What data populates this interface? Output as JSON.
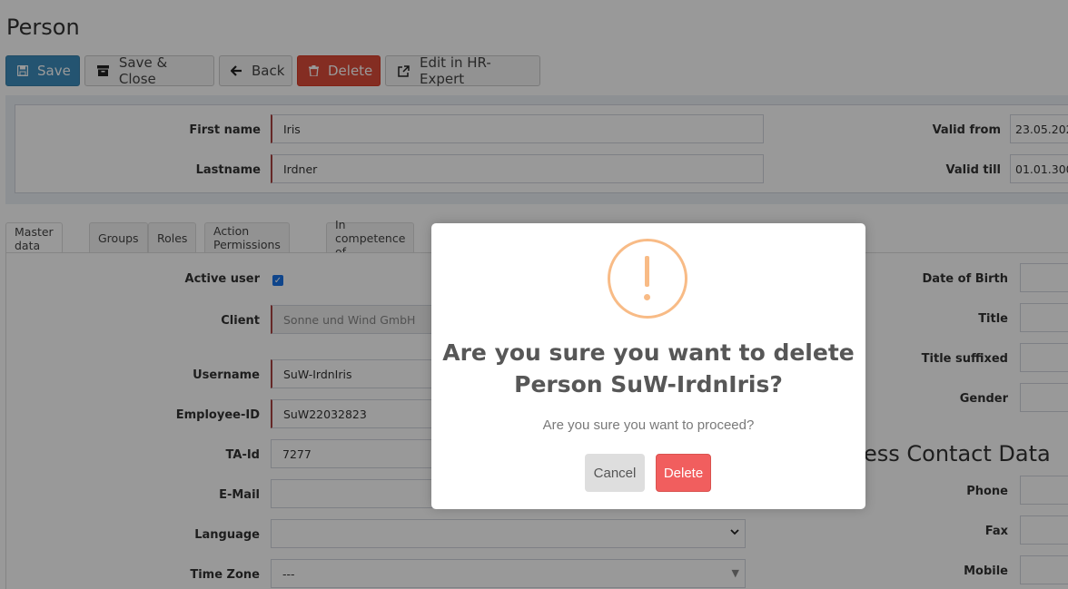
{
  "page": {
    "title": "Person"
  },
  "toolbar": {
    "save": "Save",
    "save_close": "Save & Close",
    "back": "Back",
    "delete": "Delete",
    "edit_hr": "Edit in HR-Expert"
  },
  "header": {
    "first_name_label": "First name",
    "first_name": "Iris",
    "lastname_label": "Lastname",
    "lastname": "Irdner",
    "valid_from_label": "Valid from",
    "valid_from": "23.05.202",
    "valid_till_label": "Valid till",
    "valid_till": "01.01.300"
  },
  "tabs": [
    "Master data",
    "Groups",
    "Roles",
    "Action Permissions",
    "In competence of"
  ],
  "master": {
    "active_user_label": "Active user",
    "client_label": "Client",
    "client": "Sonne und Wind GmbH",
    "username_label": "Username",
    "username": "SuW-IrdnIris",
    "employee_id_label": "Employee-ID",
    "employee_id": "SuW22032823",
    "ta_id_label": "TA-Id",
    "ta_id": "7277",
    "email_label": "E-Mail",
    "email": "",
    "language_label": "Language",
    "language": "",
    "timezone_label": "Time Zone",
    "timezone": "---",
    "dob_label": "Date of Birth",
    "title_label": "Title",
    "title_suffixed_label": "Title suffixed",
    "gender_label": "Gender",
    "business_contact_title": "ess Contact Data",
    "phone_label": "Phone",
    "fax_label": "Fax",
    "mobile_label": "Mobile"
  },
  "modal": {
    "title": "Are you sure you want to delete Person SuW-IrdnIris?",
    "text": "Are you sure you want to proceed?",
    "cancel": "Cancel",
    "delete": "Delete"
  },
  "colors": {
    "primary": "#3c8dbc",
    "danger": "#dd4b39",
    "warning_icon": "#f8bb86",
    "modal_delete": "#f15e5e"
  }
}
